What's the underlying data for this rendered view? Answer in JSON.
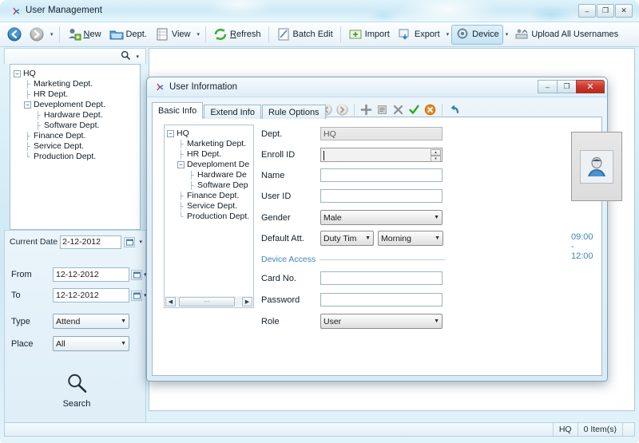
{
  "window": {
    "title": "User Management",
    "icon": "app-icon",
    "buttons": {
      "minimize": "–",
      "maximize": "❐",
      "close": "✕"
    }
  },
  "toolbar": {
    "back_icon": "back-arrow-icon",
    "forward_icon": "forward-arrow-icon",
    "nav_caret": "▾",
    "items": [
      {
        "label": "New",
        "icon": "new-user-icon",
        "accel": "N",
        "caret": false,
        "active": false
      },
      {
        "label": "Dept.",
        "icon": "department-icon",
        "accel": "",
        "caret": false,
        "active": false
      },
      {
        "label": "View",
        "icon": "view-icon",
        "accel": "",
        "caret": true,
        "active": false
      },
      {
        "label": "Refresh",
        "icon": "refresh-icon",
        "accel": "R",
        "caret": false,
        "active": false
      },
      {
        "label": "Batch Edit",
        "icon": "batch-edit-icon",
        "accel": "",
        "caret": false,
        "active": false
      },
      {
        "label": "Import",
        "icon": "import-icon",
        "accel": "",
        "caret": false,
        "active": false
      },
      {
        "label": "Export",
        "icon": "export-icon",
        "accel": "",
        "caret": true,
        "active": false
      },
      {
        "label": "Device",
        "icon": "device-icon",
        "accel": "",
        "caret": true,
        "active": true
      },
      {
        "label": "Upload All Usernames",
        "icon": "upload-icon",
        "accel": "",
        "caret": false,
        "active": false
      }
    ]
  },
  "left_panel": {
    "search_icon": "search-icon",
    "search_caret": "▾",
    "tree": [
      {
        "label": "HQ",
        "depth": 0,
        "expander": "minus"
      },
      {
        "label": "Marketing Dept.",
        "depth": 1,
        "expander": "none"
      },
      {
        "label": "HR Dept.",
        "depth": 1,
        "expander": "none"
      },
      {
        "label": "Deveploment Dept.",
        "depth": 1,
        "expander": "minus"
      },
      {
        "label": "Hardware Dept.",
        "depth": 2,
        "expander": "none"
      },
      {
        "label": "Software Dept.",
        "depth": 2,
        "expander": "none"
      },
      {
        "label": "Finance Dept.",
        "depth": 1,
        "expander": "none"
      },
      {
        "label": "Service Dept.",
        "depth": 1,
        "expander": "none"
      },
      {
        "label": "Production Dept.",
        "depth": 1,
        "expander": "none"
      }
    ],
    "filters": {
      "current_date_label": "Current Date",
      "current_date_value": "2-12-2012",
      "from_label": "From",
      "from_value": "12-12-2012",
      "to_label": "To",
      "to_value": "12-12-2012",
      "type_label": "Type",
      "type_value": "Attend",
      "place_label": "Place",
      "place_value": "All",
      "calendar_icon": "calendar-icon",
      "caret": "▾"
    },
    "search_button": {
      "label": "Search",
      "icon": "magnifier-icon"
    }
  },
  "statusbar": {
    "dept": "HQ",
    "items": "0 Item(s)"
  },
  "dialog": {
    "title": "User Information",
    "icon": "dialog-icon",
    "buttons": {
      "minimize": "–",
      "maximize": "❐",
      "close": "✕"
    },
    "tabs": [
      {
        "label": "Basic Info",
        "selected": true
      },
      {
        "label": "Extend Info",
        "selected": false
      },
      {
        "label": "Rule Options",
        "selected": false
      }
    ],
    "toolbar_icons": [
      {
        "name": "previous-record-icon",
        "glyph": "‹"
      },
      {
        "name": "next-record-icon",
        "glyph": "›"
      },
      {
        "name": "add-record-icon",
        "glyph": "+"
      },
      {
        "name": "edit-record-icon",
        "glyph": "▤"
      },
      {
        "name": "delete-record-icon",
        "glyph": "✕"
      },
      {
        "name": "confirm-icon",
        "glyph": "✓"
      },
      {
        "name": "cancel-icon",
        "glyph": "✕"
      },
      {
        "name": "undo-icon",
        "glyph": "↶"
      }
    ],
    "tree": [
      {
        "label": "HQ",
        "depth": 0,
        "expander": "minus"
      },
      {
        "label": "Marketing Dept.",
        "depth": 1,
        "expander": "none"
      },
      {
        "label": "HR Dept.",
        "depth": 1,
        "expander": "none"
      },
      {
        "label": "Deveploment De",
        "depth": 1,
        "expander": "minus"
      },
      {
        "label": "Hardware De",
        "depth": 2,
        "expander": "none"
      },
      {
        "label": "Software Dep",
        "depth": 2,
        "expander": "none"
      },
      {
        "label": "Finance Dept.",
        "depth": 1,
        "expander": "none"
      },
      {
        "label": "Service Dept.",
        "depth": 1,
        "expander": "none"
      },
      {
        "label": "Production Dept.",
        "depth": 1,
        "expander": "none"
      }
    ],
    "scroll": {
      "left_arrow": "◀",
      "right_arrow": "▶",
      "thumb_grip": "⋯"
    },
    "form": {
      "dept_label": "Dept.",
      "dept_value": "HQ",
      "enroll_id_label": "Enroll ID",
      "enroll_id_value": "",
      "name_label": "Name",
      "name_value": "",
      "user_id_label": "User ID",
      "user_id_value": "",
      "gender_label": "Gender",
      "gender_value": "Male",
      "default_att_label": "Default Att.",
      "default_att_value1": "Duty Tim",
      "default_att_value2": "Morning",
      "device_access_label": "Device Access",
      "card_no_label": "Card No.",
      "card_no_value": "",
      "password_label": "Password",
      "password_value": "",
      "role_label": "Role",
      "role_value": "User",
      "time_range": "09:00 - 12:00",
      "photo_icon": "user-avatar-icon",
      "spinner_up": "▴",
      "spinner_down": "▾",
      "combo_caret": "▾"
    }
  },
  "colors": {
    "accent_blue": "#3f86b9",
    "window_bg": "#cfe8f4",
    "dialog_close": "#cf3b2d",
    "confirm_green": "#2faa22",
    "cancel_orange": "#e8851a"
  }
}
